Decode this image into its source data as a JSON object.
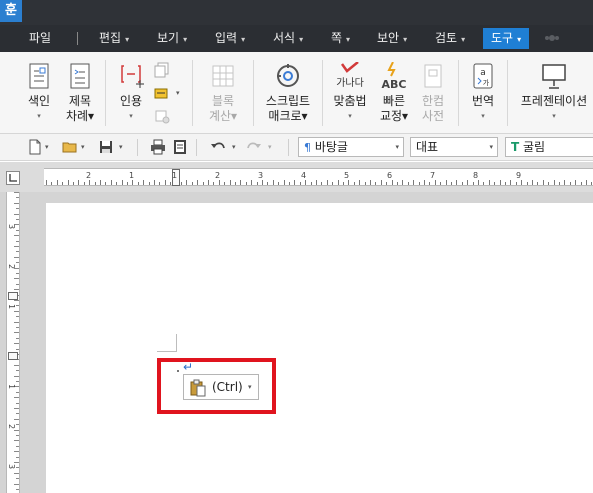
{
  "app": {
    "logo_glyph": "훈"
  },
  "menu": {
    "items": [
      {
        "label": "파일",
        "dropdown": false
      },
      {
        "label": "편집",
        "dropdown": true
      },
      {
        "label": "보기",
        "dropdown": true
      },
      {
        "label": "입력",
        "dropdown": true
      },
      {
        "label": "서식",
        "dropdown": true
      },
      {
        "label": "쪽",
        "dropdown": true
      },
      {
        "label": "보안",
        "dropdown": true
      },
      {
        "label": "검토",
        "dropdown": true
      },
      {
        "label": "도구",
        "dropdown": true,
        "active": true
      }
    ],
    "dropdown_glyph": "▾"
  },
  "ribbon": {
    "index": {
      "line1": "색인",
      "line2": "▾"
    },
    "toc": {
      "line1": "제목",
      "line2": "차례▾"
    },
    "citation": {
      "line1": "인용",
      "line2": "▾"
    },
    "block_calc": {
      "line1": "블록",
      "line2": "계산▾"
    },
    "script_macro": {
      "line1": "스크립트",
      "line2": "매크로▾"
    },
    "spellcheck": {
      "line1": "맞춤법",
      "line2": "▾",
      "icon_text": "가나다"
    },
    "quick_correct": {
      "line1": "빠른",
      "line2": "교정▾",
      "icon_text": "ABC"
    },
    "hancom_dict": {
      "line1": "한컴",
      "line2": "사전"
    },
    "translate": {
      "line1": "번역",
      "line2": "▾"
    },
    "presentation": {
      "line1": "프레젠테이션",
      "line2": "▾"
    }
  },
  "toolbar": {
    "style_value": "바탕글",
    "style_icon_text": "¶",
    "rep_value": "대표",
    "font_value": "굴림",
    "font_icon_text": "T"
  },
  "ruler": {
    "h_numbers": [
      "2",
      "1",
      "1",
      "2",
      "3",
      "4",
      "5",
      "6",
      "7",
      "8",
      "9"
    ],
    "v_numbers": [
      "3",
      "2",
      "1",
      "1",
      "2",
      "3",
      "4"
    ]
  },
  "document": {
    "paragraph_mark": "↵",
    "paste_options": {
      "label": "(Ctrl)",
      "dropdown_glyph": "▾"
    }
  },
  "colors": {
    "titlebar": "#2f3237",
    "menubar": "#2b2e33",
    "active_tab": "#1f7fd4",
    "highlight": "#e0141e"
  }
}
